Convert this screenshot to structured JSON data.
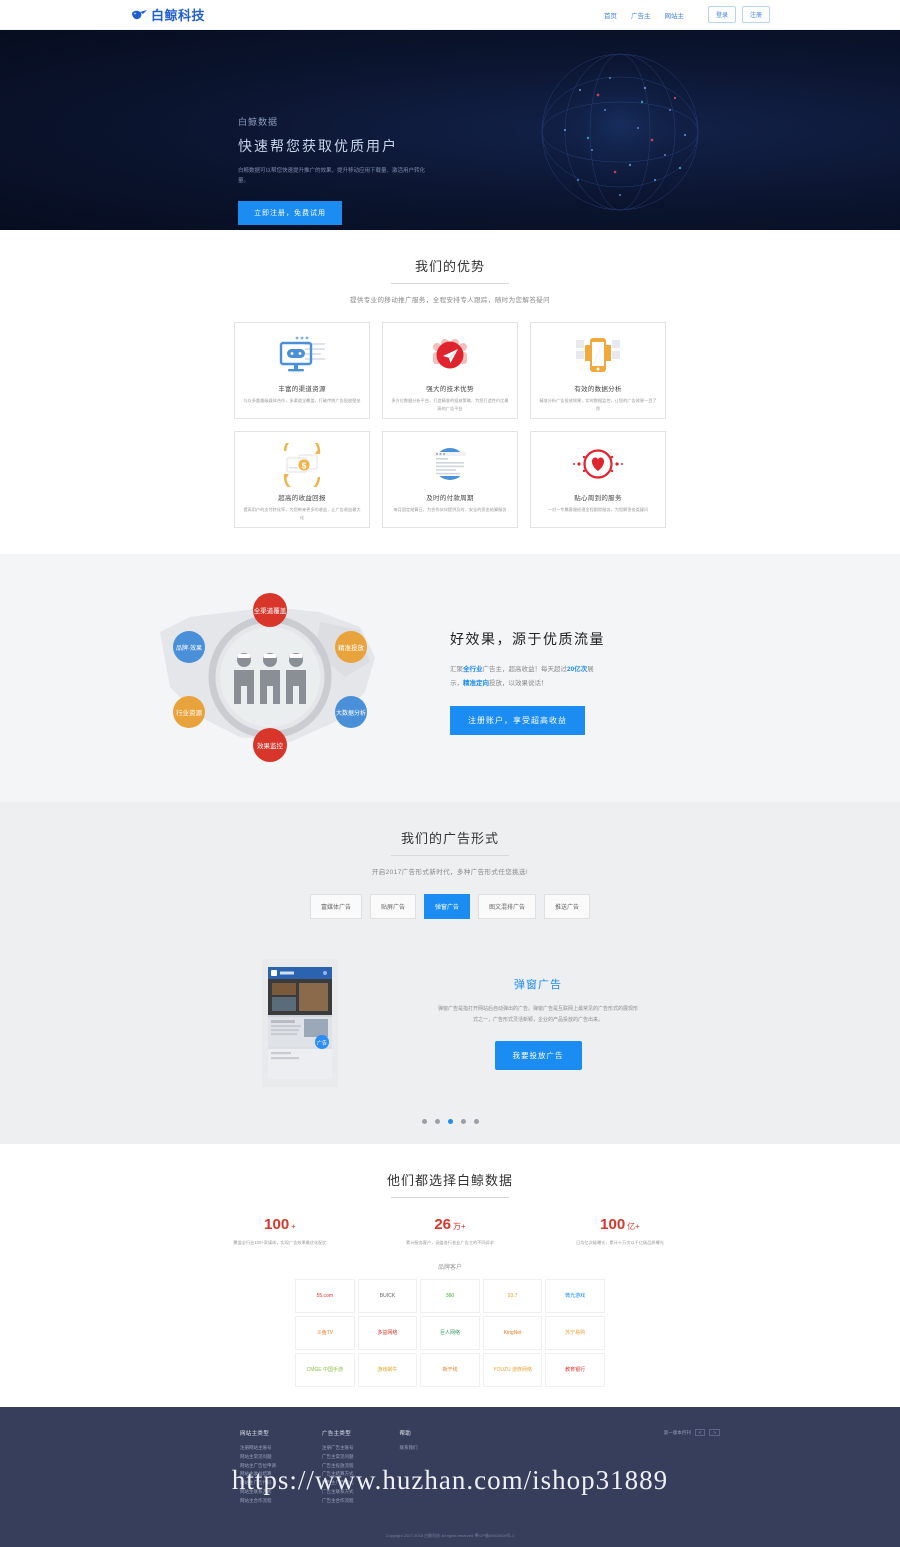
{
  "header": {
    "logo_text": "白鲸科技",
    "nav": [
      {
        "label": "首页"
      },
      {
        "label": "广告主"
      },
      {
        "label": "网站主"
      }
    ],
    "buttons": [
      {
        "label": "登录"
      },
      {
        "label": "注册"
      }
    ]
  },
  "hero": {
    "sub": "白鲸数据",
    "title": "快速帮您获取优质用户",
    "desc": "白鲸数据可以帮您快速提升推广的效果，提升移动应用下载量、激活用户转化量。",
    "cta": "立即注册，免费试用"
  },
  "advantages": {
    "title": "我们的优势",
    "subtitle": "提供专业的移动推广服务，全程安排专人跟踪，随时为您解答疑问",
    "cards": [
      {
        "icon": "monitor-game-icon",
        "title": "丰富的渠道资源",
        "desc": "与众多重量级媒体合作，多渠道全覆盖，打破传统广告投放壁垒"
      },
      {
        "icon": "paper-plane-icon",
        "title": "强大的技术优势",
        "desc": "多方位数据分析平台，打造精准的投放策略，为您打造性价比最高的广告平台"
      },
      {
        "icon": "mobile-data-icon",
        "title": "有效的数据分析",
        "desc": "精准分析广告投放效果，实时数据监控，让您的广告效果一目了然"
      },
      {
        "icon": "money-card-icon",
        "title": "超高的收益回报",
        "desc": "提高用户的支付转化率，为您带来更多的收益，让广告收益最大化"
      },
      {
        "icon": "document-window-icon",
        "title": "及时的付款周期",
        "desc": "每月固定结算日，为合作伙伴提供及时、安全的资金结算服务"
      },
      {
        "icon": "heart-service-icon",
        "title": "贴心周到的服务",
        "desc": "一对一专属客服经理全程跟踪服务，为您解答各类疑问"
      }
    ]
  },
  "traffic": {
    "title": "好效果，源于优质流量",
    "desc_parts": [
      {
        "text": "汇聚",
        "hl": false
      },
      {
        "text": "全行业",
        "hl": true
      },
      {
        "text": "广告主，超高收益！每天超过",
        "hl": false
      },
      {
        "text": "20亿次",
        "hl": true
      },
      {
        "text": "展示，",
        "hl": false
      },
      {
        "text": "精准定向",
        "hl": true
      },
      {
        "text": "投放，以效果说话！",
        "hl": false
      }
    ],
    "cta": "注册账户，享受超高收益",
    "bubbles": [
      {
        "label": "全渠道覆盖",
        "color": "#d8362a"
      },
      {
        "label": "精准投放",
        "color": "#e8a33d"
      },
      {
        "label": "大数据分析",
        "color": "#4a90d9"
      },
      {
        "label": "效果监控",
        "color": "#d8362a"
      },
      {
        "label": "行业资源",
        "color": "#e8a33d"
      },
      {
        "label": "品牌·效果",
        "color": "#4a90d9"
      }
    ]
  },
  "adformats": {
    "title": "我们的广告形式",
    "subtitle": "开启2017广告形式新时代，多种广告形式任您挑选!",
    "tabs": [
      {
        "label": "富媒体广告",
        "active": false
      },
      {
        "label": "贴屏广告",
        "active": false
      },
      {
        "label": "弹窗广告",
        "active": true
      },
      {
        "label": "图文混排广告",
        "active": false
      },
      {
        "label": "推送广告",
        "active": false
      }
    ],
    "showcase": {
      "title": "弹窗广告",
      "desc": "弹窗广告是指打开网站后自动弹出的广告。弹窗广告是互联网上最常见的广告形式的展现形式之一，广告形式灵活新颖，企业的产品投放的广告出来。",
      "cta": "我要投放广告"
    },
    "dots": 5,
    "active_dot": 3
  },
  "clients": {
    "title": "他们都选择白鲸数据",
    "stats": [
      {
        "num": "100",
        "unit": "+",
        "desc": "覆盖全行业100+家媒体，实现广告效果最优化配比"
      },
      {
        "num": "26",
        "unit": "万+",
        "desc": "累计服务客户，涵盖各行各业广告主的不同诉求"
      },
      {
        "num": "100",
        "unit": "亿+",
        "desc": "日均亿次级曝光，累计十万次以千亿级品质曝光"
      }
    ],
    "brand_label": "品牌客户",
    "logos": [
      {
        "name": "55.com",
        "color": "#d8362a"
      },
      {
        "name": "BUICK",
        "color": "#666666"
      },
      {
        "name": "360",
        "color": "#3aa935"
      },
      {
        "name": "93.7",
        "color": "#d8a82a"
      },
      {
        "name": "微光游戏",
        "color": "#1b8cf2"
      },
      {
        "name": "斗鱼TV",
        "color": "#e8791f"
      },
      {
        "name": "多益网络",
        "color": "#d8362a"
      },
      {
        "name": "巨人网络",
        "color": "#2e9e5b"
      },
      {
        "name": "KingNet",
        "color": "#e8791f"
      },
      {
        "name": "苏宁易购",
        "color": "#e8a33d"
      },
      {
        "name": "CMGE 中国手游",
        "color": "#8fc14a"
      },
      {
        "name": "游戏蜗牛",
        "color": "#d8a82a"
      },
      {
        "name": "新干线",
        "color": "#e8791f"
      },
      {
        "name": "YOUZU 游族网络",
        "color": "#e8a33d"
      },
      {
        "name": "教育银行",
        "color": "#d8362a"
      }
    ]
  },
  "footer": {
    "columns": [
      {
        "title": "网站主类型",
        "links": [
          "注册网站主账号",
          "网站主常见问题",
          "网站主广告位申请",
          "网站主收益结算",
          "网站主广告代码",
          "网站主联系方式",
          "网站主合作流程"
        ]
      },
      {
        "title": "广告主类型",
        "links": [
          "注册广告主账号",
          "广告主常见问题",
          "广告主投放流程",
          "广告主结算方式",
          "广告主广告形式",
          "广告主联系方式",
          "广告主合作流程"
        ]
      },
      {
        "title": "帮助",
        "links": [
          "联系我们"
        ]
      }
    ],
    "slider_label": "第一版本月刊",
    "slider_prev": "<",
    "slider_next": ">",
    "watermark": "https://www.huzhan.com/ishop31889",
    "copyright": "Copyright 2017-2018 白鲸科技 All rights reserved 粤ICP备00000000号-1"
  }
}
